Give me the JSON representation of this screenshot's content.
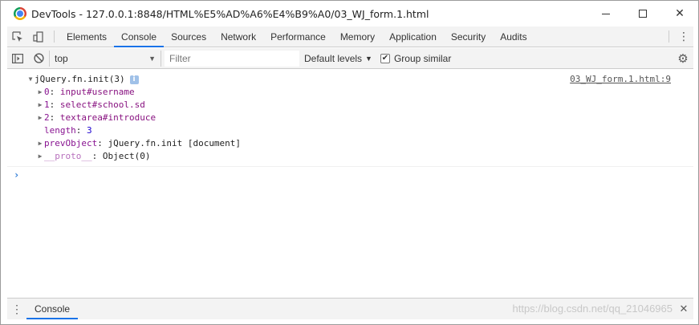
{
  "window": {
    "title": "DevTools - 127.0.0.1:8848/HTML%E5%AD%A6%E4%B9%A0/03_WJ_form.1.html"
  },
  "toolbar": {
    "tabs": [
      {
        "label": "Elements",
        "active": false
      },
      {
        "label": "Console",
        "active": true
      },
      {
        "label": "Sources",
        "active": false
      },
      {
        "label": "Network",
        "active": false
      },
      {
        "label": "Performance",
        "active": false
      },
      {
        "label": "Memory",
        "active": false
      },
      {
        "label": "Application",
        "active": false
      },
      {
        "label": "Security",
        "active": false
      },
      {
        "label": "Audits",
        "active": false
      }
    ]
  },
  "console_toolbar": {
    "context": "top",
    "filter_placeholder": "Filter",
    "levels_label": "Default levels",
    "group_similar_label": "Group similar",
    "group_similar_checked": "✔"
  },
  "console": {
    "message": {
      "header": "jQuery.fn.init(3)",
      "source": "03_WJ_form.1.html:9",
      "entries": [
        {
          "key": "0",
          "value": "input",
          "suffix": "#username"
        },
        {
          "key": "1",
          "value": "select",
          "suffix": "#school.sd"
        },
        {
          "key": "2",
          "value": "textarea",
          "suffix": "#introduce"
        }
      ],
      "length_key": "length",
      "length_value": "3",
      "prev_key": "prevObject",
      "prev_value": "jQuery.fn.init [document]",
      "proto_key": "__proto__",
      "proto_value": "Object(0)"
    },
    "prompt": "›"
  },
  "drawer": {
    "tab_label": "Console",
    "watermark": "https://blog.csdn.net/qq_21046965"
  },
  "colors": {
    "accent": "#1a73e8",
    "key": "#881391",
    "number": "#1c00cf"
  }
}
